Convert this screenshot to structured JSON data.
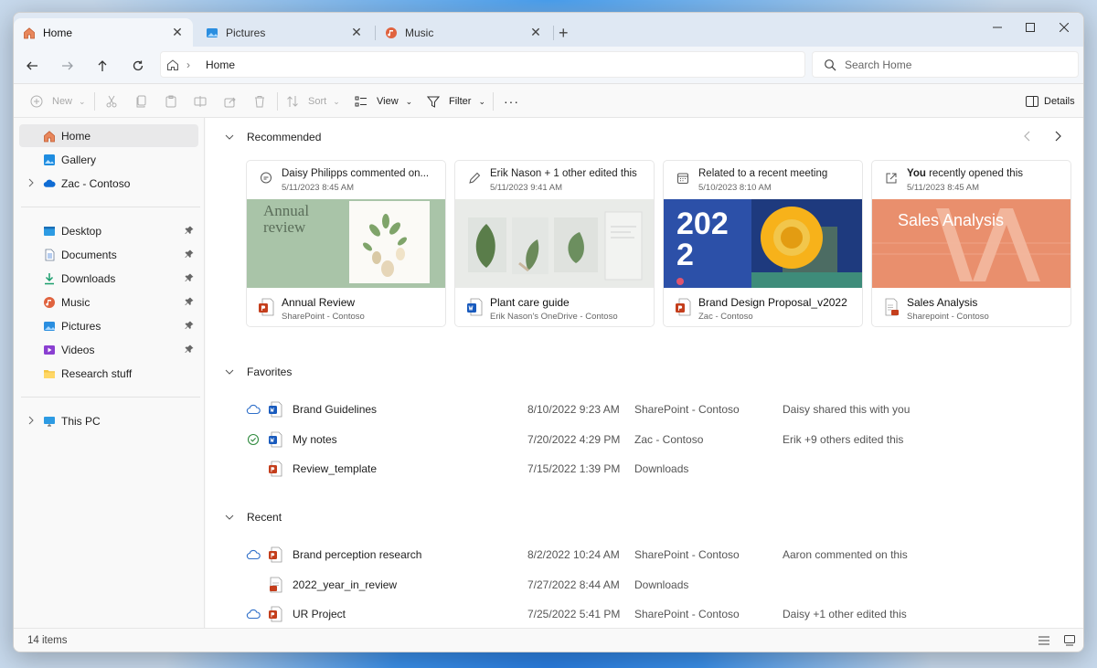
{
  "tabs": [
    {
      "label": "Home",
      "icon": "home-icon"
    },
    {
      "label": "Pictures",
      "icon": "pictures-icon"
    },
    {
      "label": "Music",
      "icon": "music-icon"
    }
  ],
  "address": {
    "path": "Home",
    "search_placeholder": "Search Home"
  },
  "toolbar": {
    "new": "New",
    "sort": "Sort",
    "view": "View",
    "filter": "Filter",
    "details": "Details"
  },
  "sidebar": {
    "top": [
      {
        "label": "Home",
        "icon": "home-icon"
      },
      {
        "label": "Gallery",
        "icon": "gallery-icon"
      },
      {
        "label": "Zac - Contoso",
        "icon": "onedrive-cloud-icon"
      }
    ],
    "pinned": [
      {
        "label": "Desktop",
        "icon": "desktop-icon"
      },
      {
        "label": "Documents",
        "icon": "documents-icon"
      },
      {
        "label": "Downloads",
        "icon": "downloads-icon"
      },
      {
        "label": "Music",
        "icon": "music-icon"
      },
      {
        "label": "Pictures",
        "icon": "pictures-icon"
      },
      {
        "label": "Videos",
        "icon": "videos-icon"
      },
      {
        "label": "Research stuff",
        "icon": "folder-icon"
      }
    ],
    "this_pc": "This PC"
  },
  "recommended": {
    "title": "Recommended",
    "cards": [
      {
        "actor": "Daisy Philipps",
        "activity": " commented on...",
        "date": "5/11/2023 8:45 AM",
        "name": "Annual Review",
        "location": "SharePoint - Contoso",
        "thumb_text": "Annual review",
        "icon": "comment-icon"
      },
      {
        "actor": "Erik Nason",
        "activity": " + 1 other edited this",
        "date": "5/11/2023 9:41 AM",
        "name": "Plant care guide",
        "location": "Erik Nason's OneDrive - Contoso",
        "thumb_text": "",
        "icon": "edit-pencil-icon"
      },
      {
        "actor": "",
        "activity": "Related to a recent meeting",
        "date": "5/10/2023 8:10 AM",
        "name": "Brand Design Proposal_v2022",
        "location": "Zac - Contoso",
        "thumb_text": "2022",
        "icon": "calendar-icon"
      },
      {
        "actor": "You",
        "activity": " recently opened this",
        "date": "5/11/2023 8:45 AM",
        "name": "Sales Analysis",
        "location": "Sharepoint - Contoso",
        "thumb_text": "Sales Analysis",
        "icon": "open-external-icon"
      }
    ]
  },
  "favorites": {
    "title": "Favorites",
    "rows": [
      {
        "name": "Brand Guidelines",
        "date": "8/10/2022 9:23 AM",
        "location": "SharePoint - Contoso",
        "activity": "Daisy shared this with you",
        "status": "cloud",
        "type": "word"
      },
      {
        "name": "My notes",
        "date": "7/20/2022 4:29 PM",
        "location": "Zac - Contoso",
        "activity": "Erik +9 others edited this",
        "status": "synced",
        "type": "word"
      },
      {
        "name": "Review_template",
        "date": "7/15/2022 1:39 PM",
        "location": "Downloads",
        "activity": "",
        "status": "",
        "type": "ppt"
      }
    ]
  },
  "recent": {
    "title": "Recent",
    "rows": [
      {
        "name": "Brand perception research",
        "date": "8/2/2022 10:24 AM",
        "location": "SharePoint - Contoso",
        "activity": "Aaron commented on this",
        "status": "cloud",
        "type": "ppt"
      },
      {
        "name": "2022_year_in_review",
        "date": "7/27/2022 8:44 AM",
        "location": "Downloads",
        "activity": "",
        "status": "",
        "type": "pdf"
      },
      {
        "name": "UR Project",
        "date": "7/25/2022 5:41 PM",
        "location": "SharePoint - Contoso",
        "activity": "Daisy +1 other edited this",
        "status": "cloud",
        "type": "ppt"
      }
    ]
  },
  "status": {
    "items": "14 items"
  },
  "colors": {
    "accent": "#0067c0",
    "ppt": "#c43e1c",
    "word": "#185abd",
    "folder": "#f4c542",
    "sales_bg": "#e98f6d",
    "annual_bg": "#a9c4a8",
    "brand_bg": "#2c50a8"
  }
}
